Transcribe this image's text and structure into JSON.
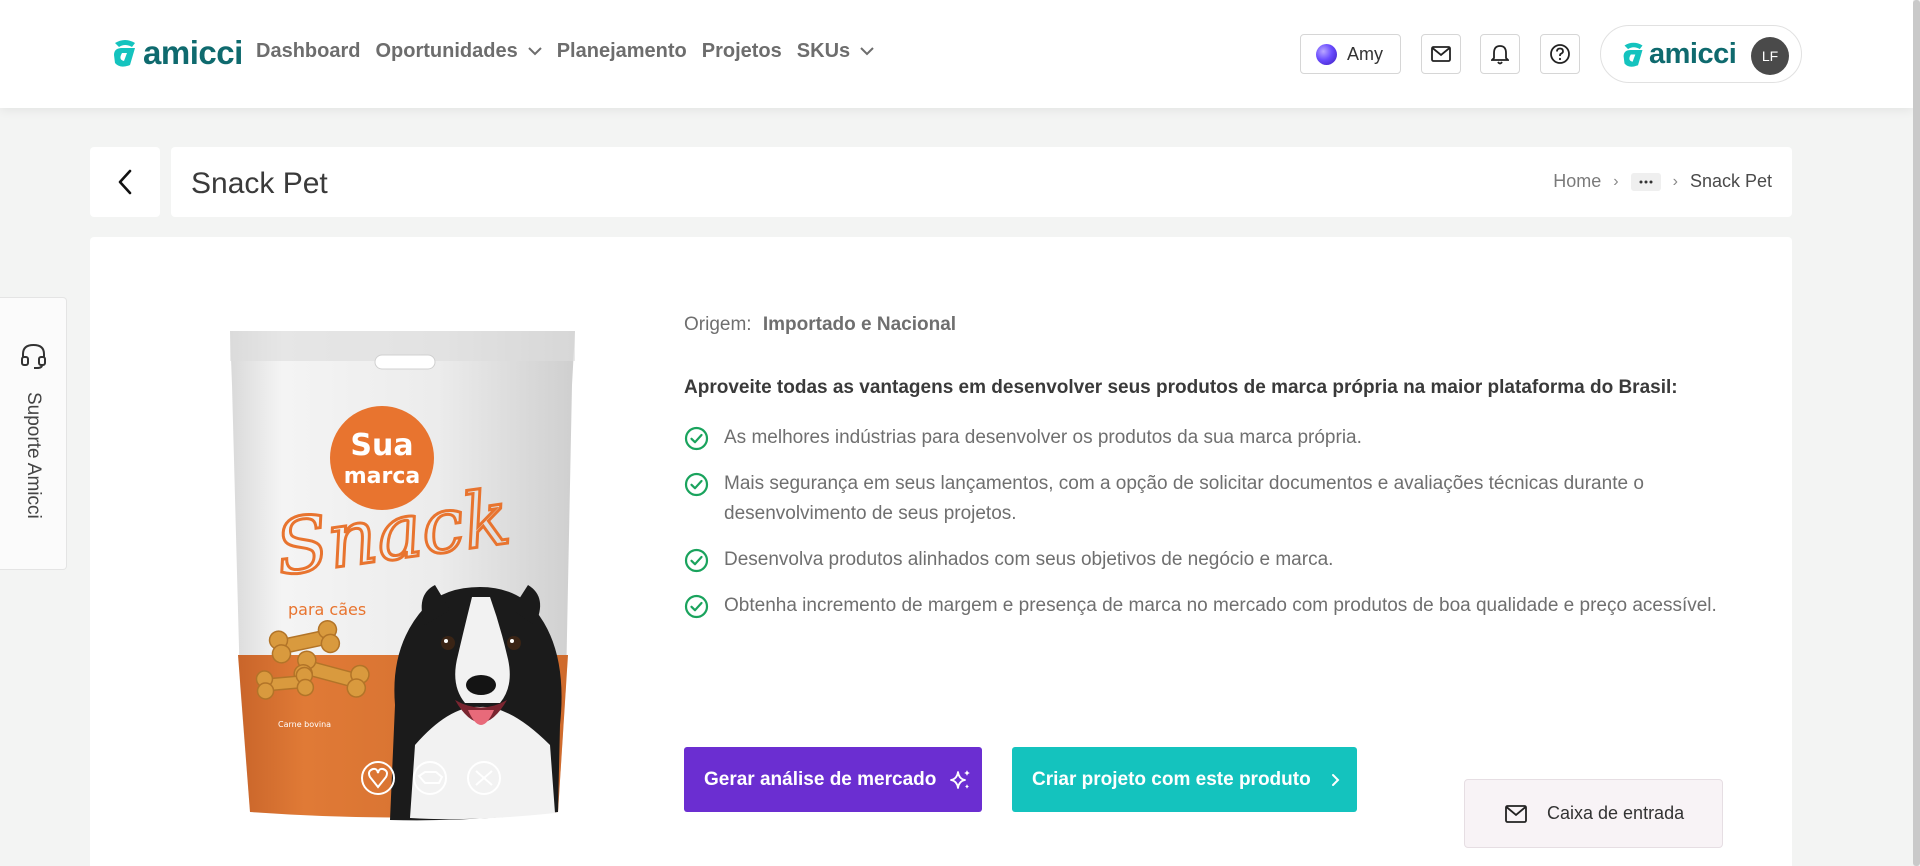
{
  "header": {
    "logo_text": "amicci",
    "nav": [
      {
        "label": "Dashboard",
        "has_dropdown": false
      },
      {
        "label": "Oportunidades",
        "has_dropdown": true
      },
      {
        "label": "Planejamento",
        "has_dropdown": false
      },
      {
        "label": "Projetos",
        "has_dropdown": false
      },
      {
        "label": "SKUs",
        "has_dropdown": true
      }
    ],
    "assistant_label": "Amy",
    "icons": [
      "mail-icon",
      "bell-icon",
      "help-icon"
    ],
    "brand_logo_text": "amicci",
    "avatar_initials": "LF"
  },
  "page": {
    "title": "Snack Pet",
    "breadcrumb": {
      "home": "Home",
      "ellipsis": "···",
      "current": "Snack Pet"
    }
  },
  "support": {
    "label": "Suporte Amicci"
  },
  "product": {
    "image": {
      "brand_line1": "Sua",
      "brand_line2": "marca",
      "product_name": "Snack",
      "subtitle": "para cães",
      "flavor": "Carne bovina"
    },
    "origin_label": "Origem:",
    "origin_value": "Importado e Nacional",
    "headline": "Aproveite todas as vantagens em desenvolver seus produtos de marca própria na maior plataforma do Brasil:",
    "benefits": [
      "As melhores indústrias para desenvolver os produtos da sua marca própria.",
      "Mais segurança em seus lançamentos, com a opção de solicitar documentos e avaliações técnicas durante o desenvolvimento de seus projetos.",
      "Desenvolva produtos alinhados com seus objetivos de negócio e marca.",
      "Obtenha incremento de margem e presença de marca no mercado com produtos de boa qualidade e preço acessível."
    ],
    "buttons": {
      "market_analysis": "Gerar análise de mercado",
      "create_project": "Criar projeto com este produto"
    }
  },
  "inbox": {
    "label": "Caixa de entrada"
  },
  "colors": {
    "brand_teal": "#14c3be",
    "brand_dark_teal": "#0f6a6e",
    "purple": "#6b2ed1",
    "check_green": "#1aa35d",
    "package_orange": "#e07a36"
  }
}
